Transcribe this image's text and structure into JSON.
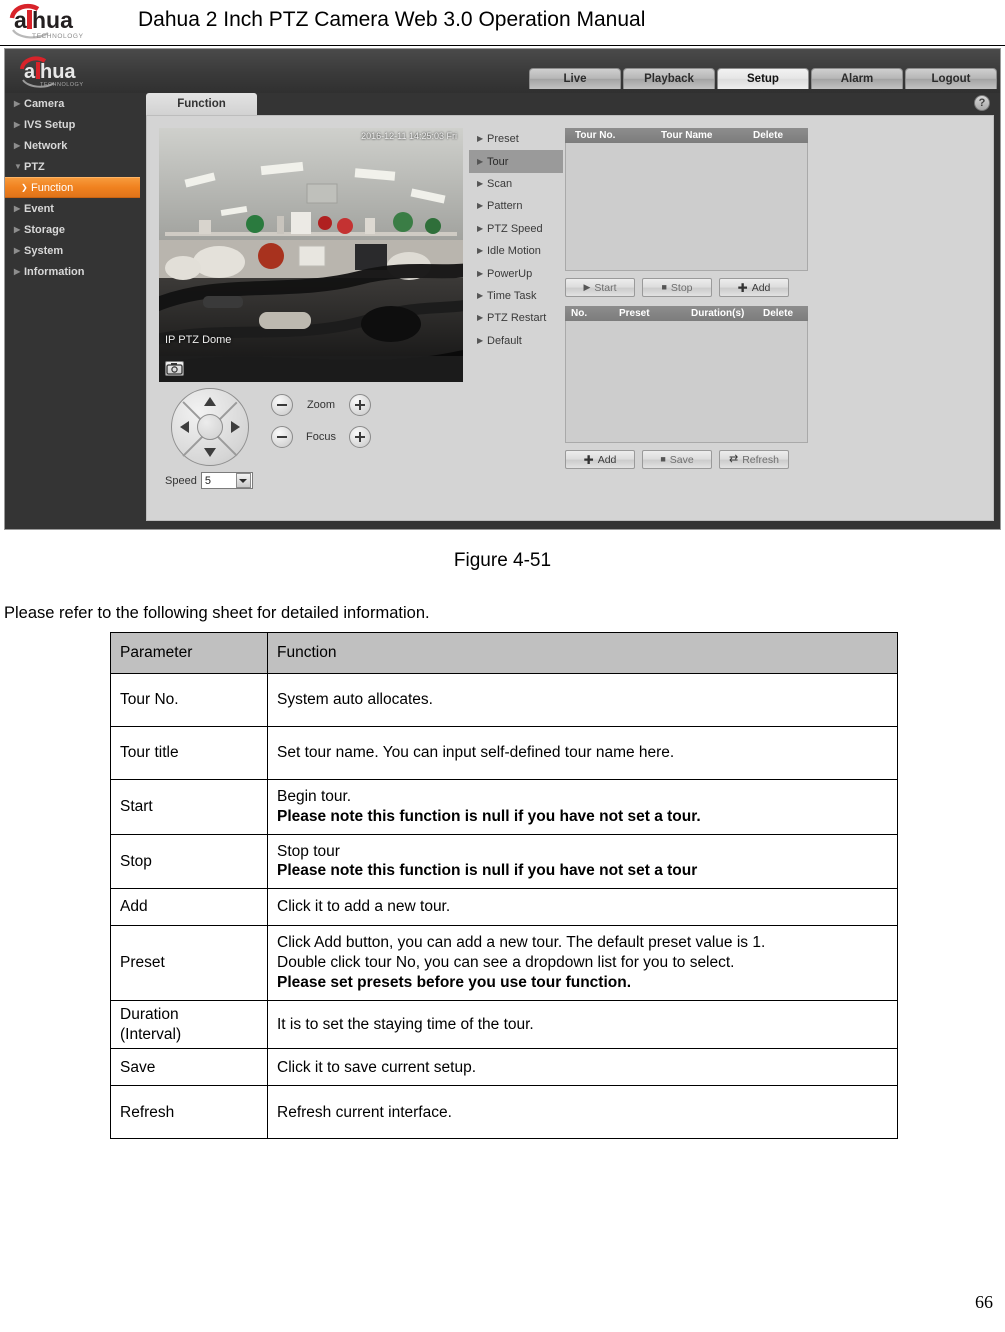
{
  "document": {
    "title": "Dahua 2 Inch PTZ Camera Web 3.0 Operation Manual",
    "logo_text": "alhua",
    "logo_sub": "TECHNOLOGY",
    "figure_caption": "Figure 4-51",
    "intro_line": "Please refer to the following sheet for detailed information.",
    "page_number": "66"
  },
  "screenshot": {
    "brand": {
      "name": "alhua",
      "sub": "TECHNOLOGY"
    },
    "nav_tabs": [
      {
        "label": "Live",
        "active": false
      },
      {
        "label": "Playback",
        "active": false
      },
      {
        "label": "Setup",
        "active": true
      },
      {
        "label": "Alarm",
        "active": false
      },
      {
        "label": "Logout",
        "active": false
      }
    ],
    "help_icon": "?",
    "sidebar": [
      {
        "label": "Camera",
        "level": "top",
        "state": "collapsed"
      },
      {
        "label": "IVS Setup",
        "level": "top",
        "state": "collapsed"
      },
      {
        "label": "Network",
        "level": "top",
        "state": "collapsed"
      },
      {
        "label": "PTZ",
        "level": "top",
        "state": "expanded"
      },
      {
        "label": "Function",
        "level": "sub",
        "state": "selected"
      },
      {
        "label": "Event",
        "level": "top",
        "state": "collapsed"
      },
      {
        "label": "Storage",
        "level": "top",
        "state": "collapsed"
      },
      {
        "label": "System",
        "level": "top",
        "state": "collapsed"
      },
      {
        "label": "Information",
        "level": "top",
        "state": "collapsed"
      }
    ],
    "content_tab": "Function",
    "video": {
      "timestamp": "2016-12-11 14:25:03 Fri",
      "channel_name": "IP PTZ Dome",
      "snapshot_icon": "camera-icon"
    },
    "ptz": {
      "speed_label": "Speed",
      "speed_value": "5",
      "zoom_label": "Zoom",
      "focus_label": "Focus",
      "minus": "−",
      "plus": "+"
    },
    "function_list": [
      {
        "label": "Preset",
        "active": false
      },
      {
        "label": "Tour",
        "active": true
      },
      {
        "label": "Scan",
        "active": false
      },
      {
        "label": "Pattern",
        "active": false
      },
      {
        "label": "PTZ Speed",
        "active": false
      },
      {
        "label": "Idle Motion",
        "active": false
      },
      {
        "label": "PowerUp",
        "active": false
      },
      {
        "label": "Time Task",
        "active": false
      },
      {
        "label": "PTZ Restart",
        "active": false
      },
      {
        "label": "Default",
        "active": false
      }
    ],
    "tour_table": {
      "columns": [
        "Tour No.",
        "Tour Name",
        "Delete"
      ],
      "rows": []
    },
    "tour_buttons": [
      {
        "label": "Start",
        "icon": "play-icon"
      },
      {
        "label": "Stop",
        "icon": "square-icon"
      },
      {
        "label": "Add",
        "icon": "plus-icon"
      }
    ],
    "preset_table": {
      "columns": [
        "No.",
        "Preset",
        "Duration(s)",
        "Delete"
      ],
      "rows": []
    },
    "preset_buttons": [
      {
        "label": "Add",
        "icon": "plus-icon"
      },
      {
        "label": "Save",
        "icon": "square-icon"
      },
      {
        "label": "Refresh",
        "icon": "refresh-icon"
      }
    ],
    "colors": {
      "accent_orange": "#f0811f",
      "panel_bg": "#d4d4d4",
      "chrome_dark": "#343434",
      "table_header": "#828282"
    }
  },
  "param_table": {
    "header": {
      "parameter": "Parameter",
      "function": "Function"
    },
    "rows": [
      {
        "parameter": "Tour No.",
        "lines": [
          {
            "text": "System auto allocates.",
            "bold": false
          }
        ]
      },
      {
        "parameter": "Tour title",
        "lines": [
          {
            "text": "Set tour name. You can input self-defined tour name here.",
            "bold": false
          }
        ]
      },
      {
        "parameter": "Start",
        "lines": [
          {
            "text": "Begin tour.",
            "bold": false
          },
          {
            "text": "Please note this function is null if you have not set a tour.",
            "bold": true
          }
        ]
      },
      {
        "parameter": "Stop",
        "lines": [
          {
            "text": "Stop tour",
            "bold": false
          },
          {
            "text": "Please note this function is null if you have not set a tour",
            "bold": true
          }
        ]
      },
      {
        "parameter": "Add",
        "lines": [
          {
            "text": "Click it to add a new tour.",
            "bold": false
          }
        ]
      },
      {
        "parameter": "Preset",
        "lines": [
          {
            "text": "Click Add button, you can add a new tour. The default preset value is 1.",
            "bold": false,
            "justify": true
          },
          {
            "text": "Double click tour No, you can see a dropdown list for you to select.",
            "bold": false,
            "justify": true
          },
          {
            "text": "Please set presets before you use tour function.",
            "bold": true
          }
        ]
      },
      {
        "parameter": "Duration (Interval)",
        "parameter_lines": [
          "Duration",
          "(Interval)"
        ],
        "lines": [
          {
            "text": "It is to set the staying time of the tour.",
            "bold": false
          }
        ]
      },
      {
        "parameter": "Save",
        "lines": [
          {
            "text": "Click it to save current setup.",
            "bold": false
          }
        ]
      },
      {
        "parameter": "Refresh",
        "lines": [
          {
            "text": "Refresh current interface.",
            "bold": false
          }
        ]
      }
    ]
  }
}
